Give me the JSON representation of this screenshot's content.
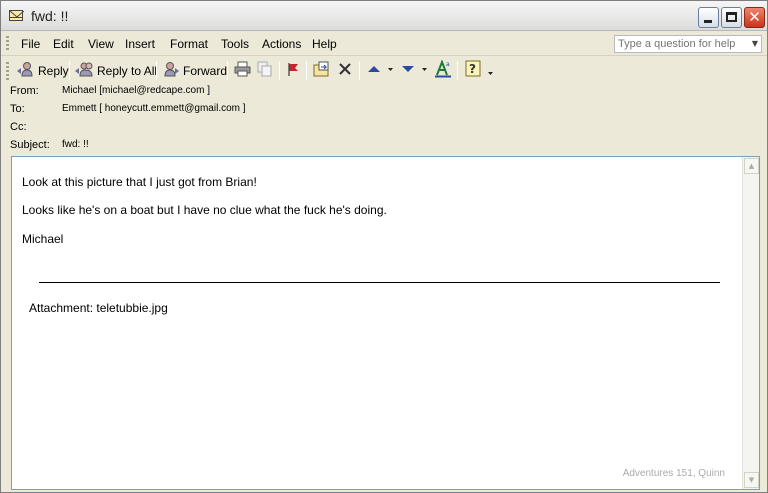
{
  "window": {
    "title": "fwd: !!"
  },
  "menu": {
    "items": [
      "File",
      "Edit",
      "View",
      "Insert",
      "Format",
      "Tools",
      "Actions",
      "Help"
    ],
    "help_placeholder": "Type a question for help"
  },
  "toolbar": {
    "reply": "Reply",
    "reply_all": "Reply to All",
    "forward": "Forward"
  },
  "header": {
    "from_label": "From:",
    "from_value": "Michael [michael@redcape.com ]",
    "to_label": "To:",
    "to_value": "Emmett [ honeycutt.emmett@gmail.com ]",
    "cc_label": "Cc:",
    "cc_value": "",
    "subject_label": "Subject:",
    "subject_value": "fwd: !!"
  },
  "message": {
    "line1": "Look at this picture that I just got from Brian!",
    "line2": "Looks like he's on a boat but I have no clue what the fuck he's doing.",
    "signature": "Michael",
    "attachment": "Attachment: teletubbie.jpg",
    "credit": "Adventures 151, Quinn"
  }
}
